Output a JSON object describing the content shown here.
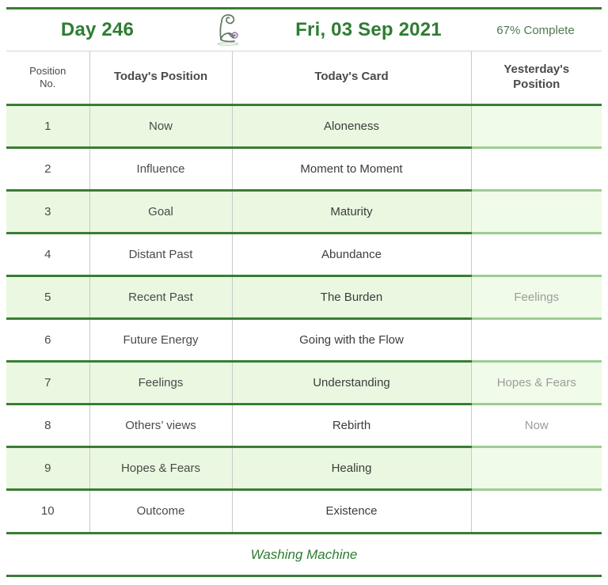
{
  "header": {
    "day_label": "Day 246",
    "icon_name": "kneeling-figure-icon",
    "date_label": "Fri, 03 Sep 2021",
    "progress_label": "67% Complete"
  },
  "table": {
    "columns": [
      "Position No.",
      "Today's Position",
      "Today's Card",
      "Yesterday's Position"
    ],
    "column_lines": {
      "c1_line1": "Position",
      "c1_line2": "No.",
      "c4_line1": "Yesterday's",
      "c4_line2": "Position"
    },
    "rows": [
      {
        "no": "1",
        "position": "Now",
        "card": "Aloneness",
        "yesterday": ""
      },
      {
        "no": "2",
        "position": "Influence",
        "card": "Moment to Moment",
        "yesterday": ""
      },
      {
        "no": "3",
        "position": "Goal",
        "card": "Maturity",
        "yesterday": ""
      },
      {
        "no": "4",
        "position": "Distant Past",
        "card": "Abundance",
        "yesterday": ""
      },
      {
        "no": "5",
        "position": "Recent Past",
        "card": "The Burden",
        "yesterday": "Feelings"
      },
      {
        "no": "6",
        "position": "Future Energy",
        "card": "Going with the Flow",
        "yesterday": ""
      },
      {
        "no": "7",
        "position": "Feelings",
        "card": "Understanding",
        "yesterday": "Hopes & Fears"
      },
      {
        "no": "8",
        "position": "Others’ views",
        "card": "Rebirth",
        "yesterday": "Now"
      },
      {
        "no": "9",
        "position": "Hopes & Fears",
        "card": "Healing",
        "yesterday": ""
      },
      {
        "no": "10",
        "position": "Outcome",
        "card": "Existence",
        "yesterday": ""
      }
    ]
  },
  "footer": {
    "spread_name": "Washing Machine"
  },
  "colors": {
    "green_rule": "#3a7d34",
    "green_title": "#2e7d32",
    "row_shade": "#eaf8e1",
    "row_shade_light": "#f0fbe9",
    "progress_text": "#4e7a50",
    "muted_text": "#9c9c9c"
  }
}
